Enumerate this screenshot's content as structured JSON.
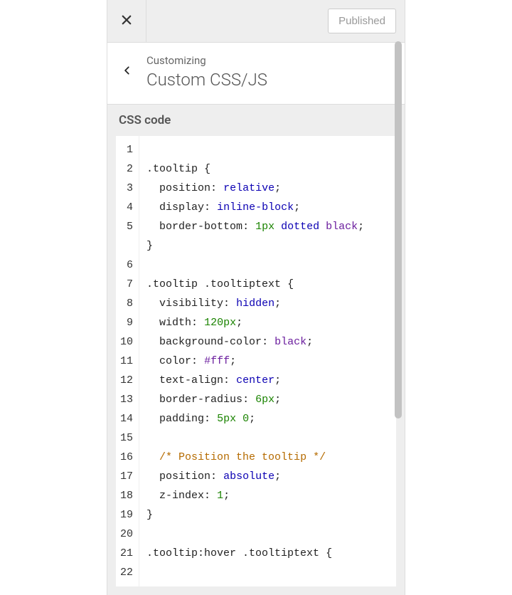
{
  "topbar": {
    "published_label": "Published"
  },
  "header": {
    "crumb": "Customizing",
    "title": "Custom CSS/JS"
  },
  "section": {
    "label": "CSS code"
  },
  "editor": {
    "gutter_start": 1,
    "gutter_end": 22,
    "lines": [
      "",
      ".tooltip {",
      "  position: relative;",
      "  display: inline-block;",
      "  border-bottom: 1px dotted black;",
      "}",
      "",
      ".tooltip .tooltiptext {",
      "  visibility: hidden;",
      "  width: 120px;",
      "  background-color: black;",
      "  color: #fff;",
      "  text-align: center;",
      "  border-radius: 6px;",
      "  padding: 5px 0;",
      "",
      "  /* Position the tooltip */",
      "  position: absolute;",
      "  z-index: 1;",
      "}",
      "",
      ".tooltip:hover .tooltiptext {"
    ]
  }
}
